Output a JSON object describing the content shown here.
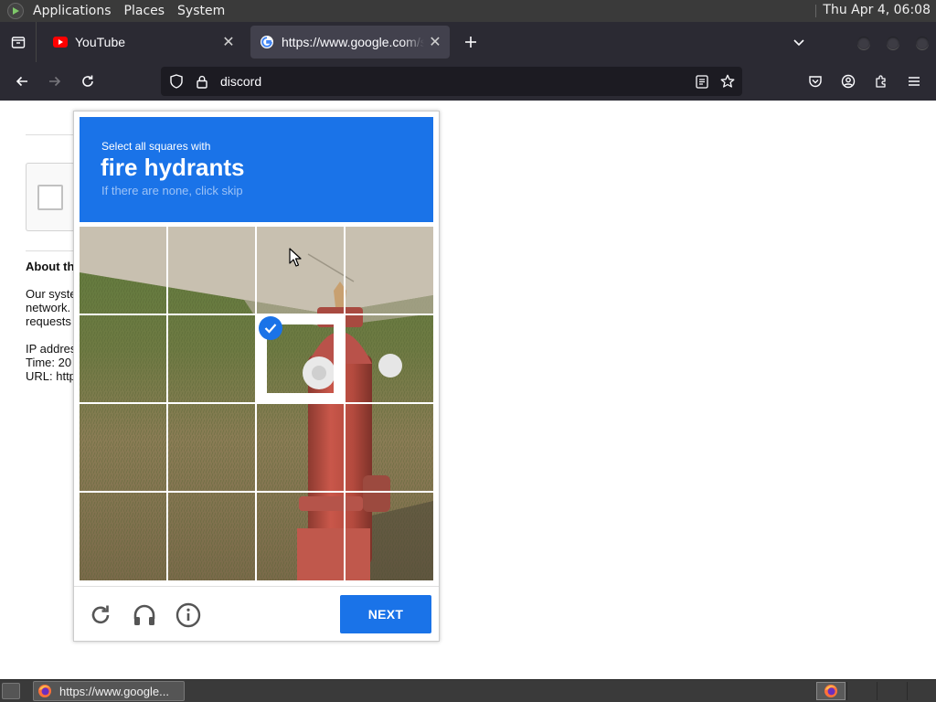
{
  "top_panel": {
    "menus": [
      "Applications",
      "Places",
      "System"
    ],
    "clock": "Thu Apr  4, 06:08"
  },
  "tabs": [
    {
      "title": "YouTube",
      "icon": "youtube-icon",
      "active": false
    },
    {
      "title": "https://www.google.com/sorry/index?continue=https://www.google.com/search",
      "icon": "google-icon",
      "active": true
    }
  ],
  "urlbar": {
    "text": "discord"
  },
  "page": {
    "about_heading": "About th",
    "body_lines": [
      "Our syste",
      "network.",
      "requests",
      "",
      "IP addres",
      "Time: 20",
      "URL: http"
    ]
  },
  "challenge": {
    "instruction": "Select all squares with",
    "target": "fire hydrants",
    "hint": "If there are none, click skip",
    "grid": {
      "rows": 4,
      "cols": 4,
      "selected": [
        [
          1,
          2
        ]
      ]
    },
    "next_label": "NEXT",
    "accent_color": "#1a73e8"
  },
  "taskbar": {
    "task_label": "https://www.google...",
    "workspaces": 4,
    "active_workspace": 1
  }
}
